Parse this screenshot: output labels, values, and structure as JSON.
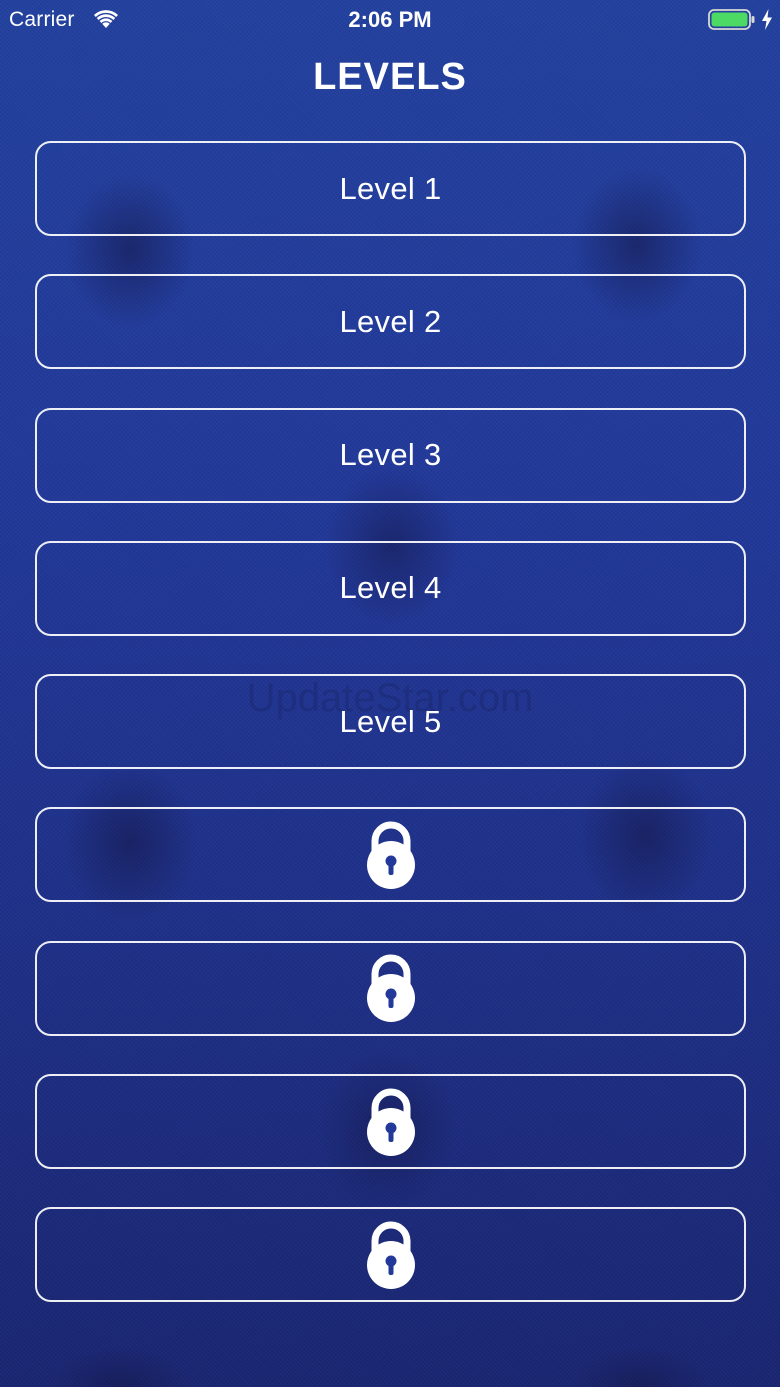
{
  "status_bar": {
    "carrier": "Carrier",
    "time": "2:06 PM",
    "battery_color": "#4cd964"
  },
  "title": "LEVELS",
  "watermark": "UpdateStar.com",
  "levels": [
    {
      "label": "Level 1",
      "locked": false
    },
    {
      "label": "Level 2",
      "locked": false
    },
    {
      "label": "Level 3",
      "locked": false
    },
    {
      "label": "Level 4",
      "locked": false
    },
    {
      "label": "Level 5",
      "locked": false
    },
    {
      "label": "",
      "locked": true,
      "icon": "lock-icon"
    },
    {
      "label": "",
      "locked": true,
      "icon": "lock-icon"
    },
    {
      "label": "",
      "locked": true,
      "icon": "lock-icon"
    },
    {
      "label": "",
      "locked": true,
      "icon": "lock-icon"
    }
  ],
  "colors": {
    "background": "#22399a",
    "button_border": "#ffffff",
    "text": "#ffffff"
  }
}
